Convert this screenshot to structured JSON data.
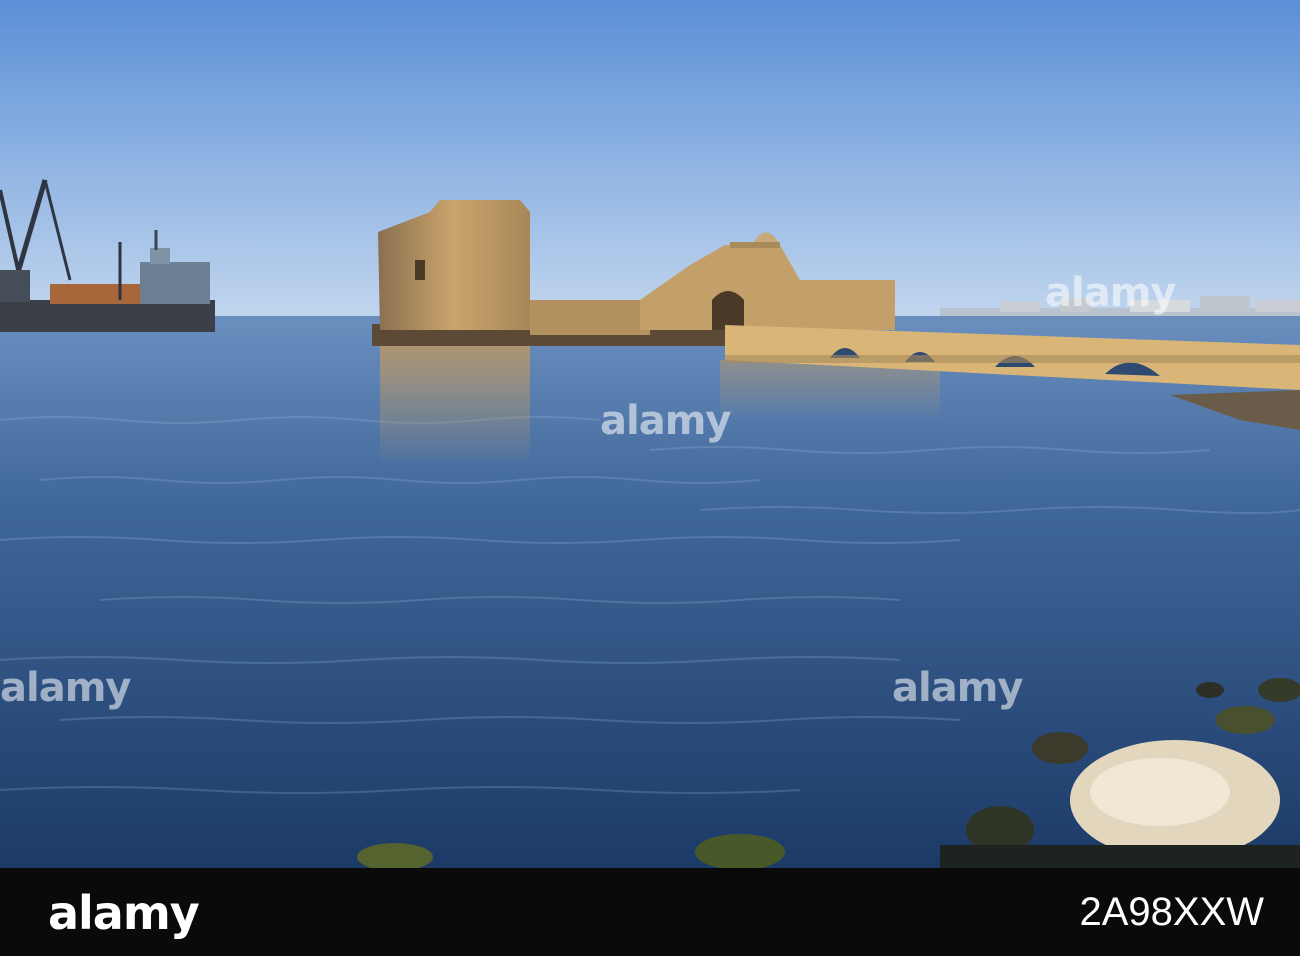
{
  "stock_photo": {
    "brand": "alamy",
    "image_code": "2A98XXW",
    "watermark_text": "alamy"
  },
  "colors": {
    "sky_top": "#5a8fd6",
    "sky_bottom": "#b9d0ea",
    "sea_top": "#4f76a8",
    "sea_bottom": "#1d3f6f",
    "stone": "#c9a36a",
    "stone_shadow": "#7d6446",
    "footer": "#0a0a0a"
  }
}
